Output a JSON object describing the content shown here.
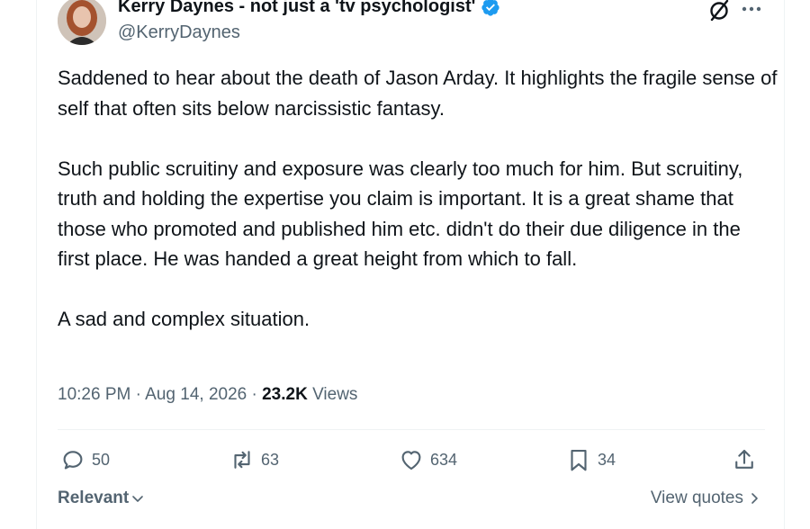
{
  "author": {
    "display_name": "Kerry Daynes - not just a 'tv psychologist'",
    "handle": "@KerryDaynes",
    "verified_icon": "verified-badge-icon",
    "avatar_icon": "avatar"
  },
  "tweet": {
    "paragraphs": [
      "Saddened to hear about the death of Jason Arday. It highlights the fragile sense of self that often sits below narcissistic fantasy.",
      "Such public scruitiny and exposure was clearly too much for him. But scruitiny, truth and holding the expertise you claim is important. It is a great shame that those who promoted and published him etc. didn't do their due diligence in the first place. He was handed a great height from which to fall.",
      "A sad and complex situation."
    ],
    "time": "10:26 PM",
    "separator": "·",
    "date": "Aug 14, 2026",
    "views_count": "23.2K",
    "views_label": "Views"
  },
  "actions": {
    "replies": "50",
    "reposts": "63",
    "likes": "634",
    "bookmarks": "34"
  },
  "footer": {
    "sort_label": "Relevant",
    "view_quotes_label": "View quotes"
  },
  "colors": {
    "text_primary": "#0f1419",
    "text_secondary": "#536471",
    "verified_blue": "#1d9bf0",
    "divider": "#eff3f4"
  }
}
